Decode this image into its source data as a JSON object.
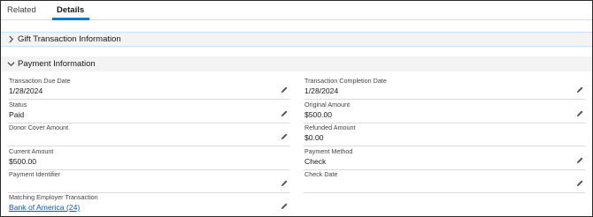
{
  "tabs": [
    {
      "label": "Related",
      "active": false
    },
    {
      "label": "Details",
      "active": true
    }
  ],
  "sections": {
    "gift": {
      "title": "Gift Transaction Information",
      "expanded": false
    },
    "payment": {
      "title": "Payment Information",
      "expanded": true
    }
  },
  "fields": {
    "transaction_due_date": {
      "label": "Transaction Due Date",
      "value": "1/28/2024"
    },
    "transaction_completion_date": {
      "label": "Transaction Completion Date",
      "value": "1/28/2024"
    },
    "status": {
      "label": "Status",
      "value": "Paid"
    },
    "original_amount": {
      "label": "Original Amount",
      "value": "$500.00"
    },
    "donor_cover_amount": {
      "label": "Donor Cover Amount",
      "value": ""
    },
    "refunded_amount": {
      "label": "Refunded Amount",
      "value": "$0.00"
    },
    "current_amount": {
      "label": "Current Amount",
      "value": "$500.00"
    },
    "payment_method": {
      "label": "Payment Method",
      "value": "Check"
    },
    "payment_identifier": {
      "label": "Payment Identifier",
      "value": ""
    },
    "check_date": {
      "label": "Check Date",
      "value": ""
    },
    "matching_employer_transaction": {
      "label": "Matching Employer Transaction",
      "value": "Bank of America (24)"
    }
  },
  "icons": {
    "edit": "pencil-icon",
    "collapsed": "chevron-right-icon",
    "expanded": "chevron-down-icon"
  },
  "colors": {
    "accent": "#0176d3",
    "link": "#0b5cab"
  }
}
